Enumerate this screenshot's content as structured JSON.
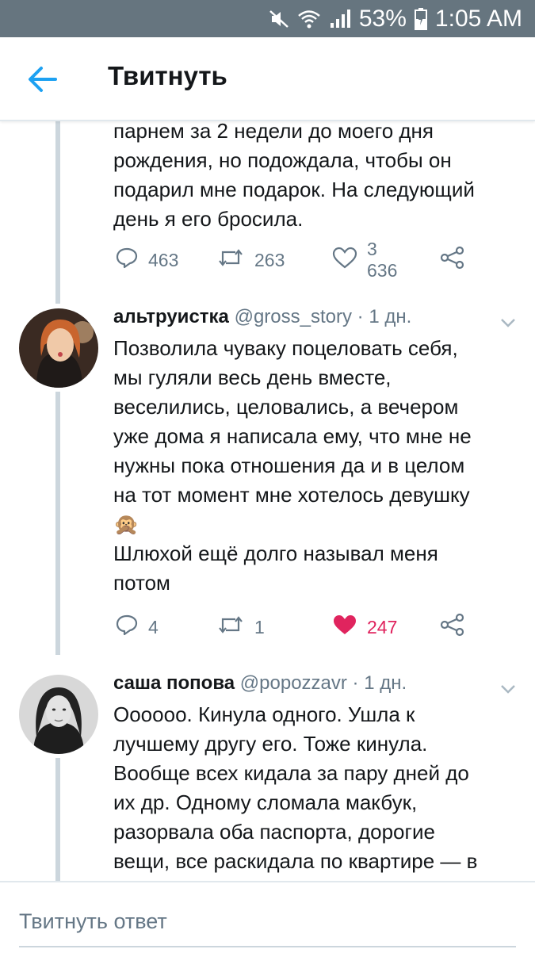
{
  "status_bar": {
    "icons": [
      "mute-icon",
      "wifi-icon",
      "signal-icon",
      "battery-charging-icon"
    ],
    "battery": "53%",
    "time": "1:05 AM"
  },
  "header": {
    "title": "Твитнуть",
    "back_icon": "arrow-left-icon"
  },
  "colors": {
    "accent": "#1da1f2",
    "like": "#e0245e",
    "muted": "#657786",
    "status_bar": "#66757f"
  },
  "tweets": [
    {
      "text_lines": [
        "парнем за 2 недели до моего дня",
        "рождения, но подождала, чтобы он",
        "подарил мне подарок. На следующий",
        "день я его бросила."
      ],
      "replies": "463",
      "retweets": "263",
      "likes": "3 636",
      "liked": false
    },
    {
      "name": "альтруистка",
      "handle": "@gross_story",
      "time": "· 1 дн.",
      "text_lines": [
        "Позволила чуваку поцеловать себя,",
        "мы гуляли весь день вместе,",
        "веселились, целовались, а вечером",
        "уже дома я написала ему, что мне не",
        "нужны пока отношения да и в целом",
        "на тот момент мне хотелось девушку",
        "🙊",
        "Шлюхой ещё долго называл меня",
        "потом"
      ],
      "replies": "4",
      "retweets": "1",
      "likes": "247",
      "liked": true
    },
    {
      "name": "саша попова",
      "handle": "@popozzavr",
      "time": "· 1 дн.",
      "text_lines": [
        "Оооооо. Кинула одного. Ушла к",
        "лучшему другу его. Тоже кинула.",
        "Вообще всех кидала за пару дней до",
        "их др. Одному сломала макбук,",
        "разорвала оба паспорта, дорогие",
        "вещи, все раскидала по квартире — в"
      ]
    }
  ],
  "reply_bar": {
    "placeholder": "Твитнуть ответ"
  }
}
